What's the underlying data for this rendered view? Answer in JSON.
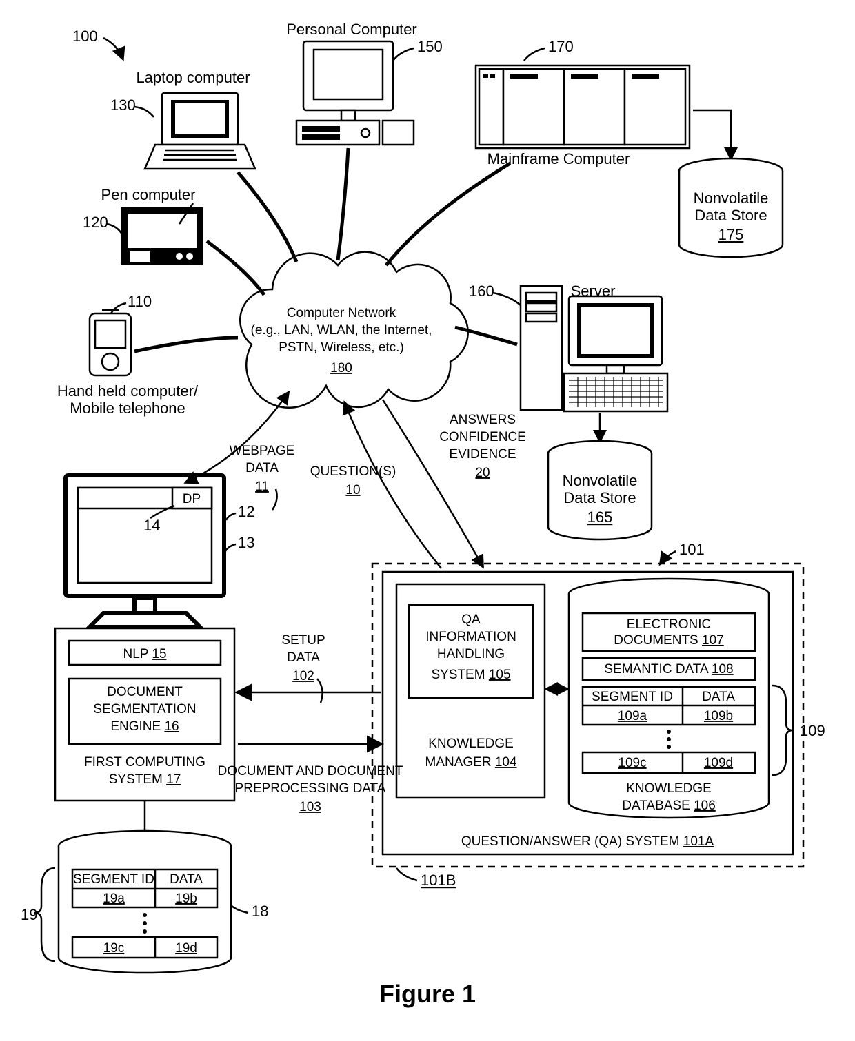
{
  "figure_label": "Figure 1",
  "ref_numbers": {
    "overall": "100",
    "handheld": "110",
    "pen": "120",
    "laptop": "130",
    "pc": "150",
    "mainframe": "170",
    "mainframe_store": "175",
    "server": "160",
    "server_store": "165",
    "cloud": "180",
    "qa_block": "101",
    "qa_system": "101A",
    "qa_dashed": "101B",
    "setup_data": "102",
    "doc_preproc": "103",
    "webpage_data": "11",
    "questions": "10",
    "answers": "20",
    "monitor": "12",
    "monitor_base": "13",
    "dp": "14",
    "nlp": "15",
    "engine": "16",
    "first_system": "17",
    "first_db": "18",
    "first_db_brace": "19",
    "first_db_a": "19a",
    "first_db_b": "19b",
    "first_db_c": "19c",
    "first_db_d": "19d",
    "km": "104",
    "qa_ihs": "105",
    "kdb": "106",
    "edocs": "107",
    "semdata": "108",
    "kdb_brace": "109",
    "kdb_a": "109a",
    "kdb_b": "109b",
    "kdb_c": "109c",
    "kdb_d": "109d"
  },
  "labels": {
    "handheld_l1": "Hand held computer/",
    "handheld_l2": "Mobile telephone",
    "pen": "Pen computer",
    "laptop": "Laptop computer",
    "pc": "Personal Computer",
    "mainframe": "Mainframe Computer",
    "server": "Server",
    "nv_store_l1": "Nonvolatile",
    "nv_store_l2": "Data Store",
    "cloud_l1": "Computer Network",
    "cloud_l2": "(e.g., LAN, WLAN, the Internet,",
    "cloud_l3": "PSTN, Wireless, etc.)",
    "webpage_l1": "WEBPAGE",
    "webpage_l2": "DATA",
    "questions": "QUESTION(S)",
    "answers_l1": "ANSWERS",
    "answers_l2": "CONFIDENCE",
    "answers_l3": "EVIDENCE",
    "dp": "DP",
    "nlp": "NLP ",
    "engine_l1": "DOCUMENT",
    "engine_l2": "SEGMENTATION",
    "engine_l3": "ENGINE ",
    "first_sys_l1": "FIRST COMPUTING",
    "first_sys_l2": "SYSTEM ",
    "setup_l1": "SETUP",
    "setup_l2": "DATA",
    "docpre_l1": "DOCUMENT AND DOCUMENT",
    "docpre_l2": "PREPROCESSING DATA",
    "seg_id": "SEGMENT ID",
    "data_col": "DATA",
    "km_l1": "KNOWLEDGE",
    "km_l2": "MANAGER ",
    "qihs_l1": "QA",
    "qihs_l2": "INFORMATION",
    "qihs_l3": "HANDLING",
    "qihs_l4": "SYSTEM ",
    "edocs_l1": "ELECTRONIC",
    "edocs_l2": "DOCUMENTS ",
    "semdata": "SEMANTIC DATA ",
    "kdb_l1": "KNOWLEDGE",
    "kdb_l2": "DATABASE ",
    "qa_title": "QUESTION/ANSWER (QA) SYSTEM "
  }
}
